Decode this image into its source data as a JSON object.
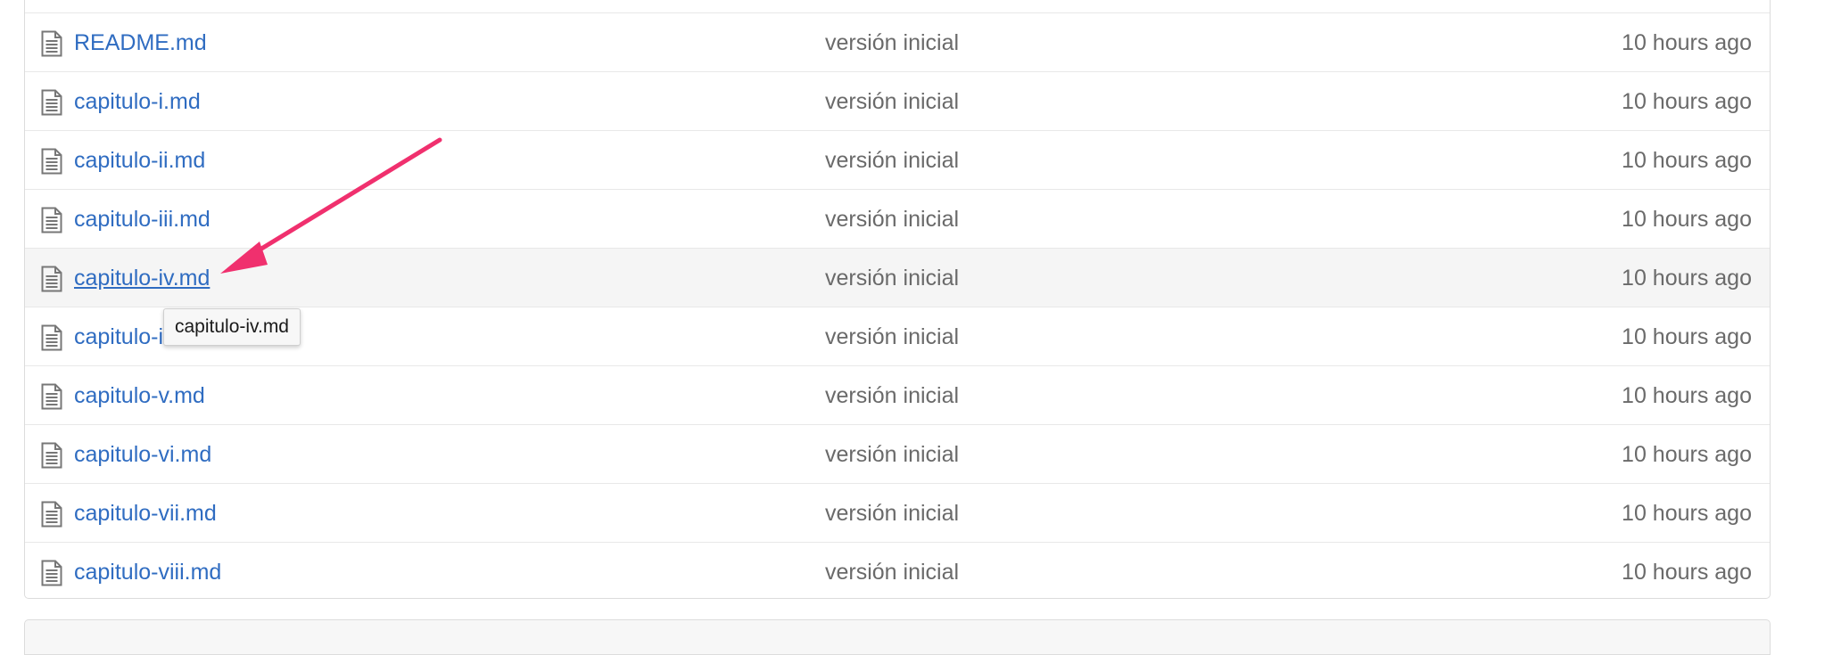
{
  "files": [
    {
      "name": "README.md",
      "message": "versión inicial",
      "age": "10 hours ago"
    },
    {
      "name": "capitulo-i.md",
      "message": "versión inicial",
      "age": "10 hours ago"
    },
    {
      "name": "capitulo-ii.md",
      "message": "versión inicial",
      "age": "10 hours ago"
    },
    {
      "name": "capitulo-iii.md",
      "message": "versión inicial",
      "age": "10 hours ago"
    },
    {
      "name": "capitulo-iv.md",
      "message": "versión inicial",
      "age": "10 hours ago"
    },
    {
      "name": "capitulo-ix.md",
      "message": "versión inicial",
      "age": "10 hours ago"
    },
    {
      "name": "capitulo-v.md",
      "message": "versión inicial",
      "age": "10 hours ago"
    },
    {
      "name": "capitulo-vi.md",
      "message": "versión inicial",
      "age": "10 hours ago"
    },
    {
      "name": "capitulo-vii.md",
      "message": "versión inicial",
      "age": "10 hours ago"
    },
    {
      "name": "capitulo-viii.md",
      "message": "versión inicial",
      "age": "10 hours ago"
    }
  ],
  "hovered_file": "capitulo-iv.md",
  "tooltip": {
    "text": "capitulo-iv.md"
  },
  "icons": {
    "file": "file-text-icon",
    "annotation": "arrow-annotation"
  },
  "colors": {
    "link": "#2f6cc1",
    "muted_text": "#6a6a6a",
    "hover_row": "#f5f5f5",
    "border": "#dcdcdc",
    "annotation": "#f0306e"
  }
}
